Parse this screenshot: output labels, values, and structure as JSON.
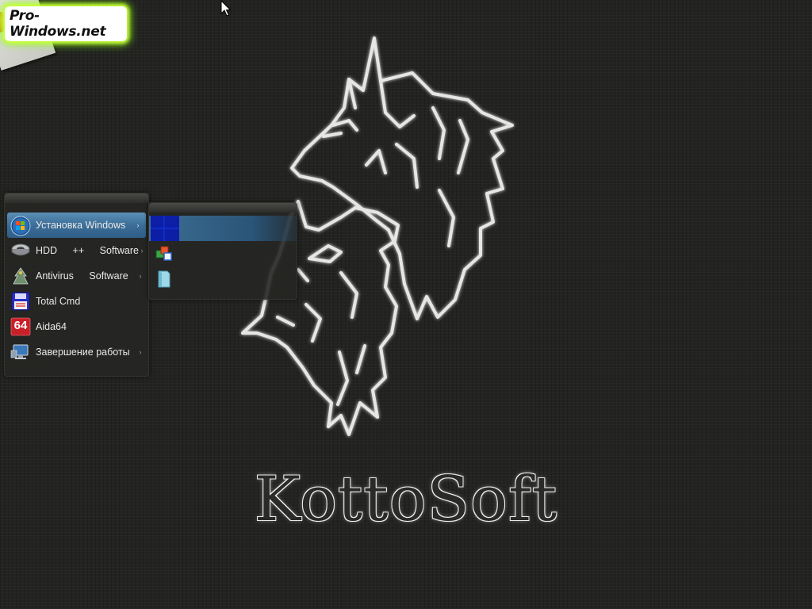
{
  "watermark": {
    "text": "Pro-Windows.net"
  },
  "brand": {
    "text": "KottoSoft"
  },
  "main_menu": {
    "items": [
      {
        "label": "Установка Windows",
        "icon": "windows-orb-icon",
        "has_submenu": true,
        "active": true
      },
      {
        "label": "HDD ++ Software",
        "icon": "hard-disk-icon",
        "has_submenu": true
      },
      {
        "label": "Antivirus Software",
        "icon": "antivirus-icon",
        "has_submenu": true
      },
      {
        "label": "Total Cmd",
        "icon": "floppy-disk-icon",
        "has_submenu": false
      },
      {
        "label": "Aida64",
        "icon": "aida64-icon",
        "has_submenu": false
      },
      {
        "label": "Завершение работы",
        "icon": "shutdown-computer-icon",
        "has_submenu": true
      }
    ],
    "aida_icon_text": "64",
    "arrow_glyph": "›"
  },
  "sub_menu": {
    "items": [
      {
        "icon": "windows-tiles-icon",
        "active": true
      },
      {
        "icon": "windows-flag-icon"
      },
      {
        "icon": "document-icon"
      }
    ]
  },
  "colors": {
    "desktop_bg": "#232421",
    "menu_highlight": "#3c6e97",
    "sub_highlight_tile": "#0d1ea6",
    "watermark_glow": "#c8ff3a"
  }
}
